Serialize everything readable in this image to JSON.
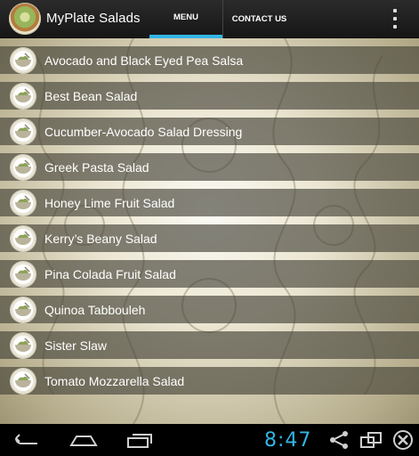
{
  "app": {
    "title": "MyPlate Salads",
    "logo_icon": "salad-plate-icon",
    "accent_color": "#33b5e5"
  },
  "tabs": [
    {
      "label": "MENU",
      "selected": true
    },
    {
      "label": "CONTACT US",
      "selected": false
    }
  ],
  "overflow_icon": "vertical-ellipsis-icon",
  "menu": {
    "item_icon": "salad-bowl-icon",
    "items": [
      {
        "label": "Avocado and Black Eyed Pea Salsa"
      },
      {
        "label": "Best Bean Salad"
      },
      {
        "label": "Cucumber-Avocado Salad Dressing"
      },
      {
        "label": "Greek Pasta Salad"
      },
      {
        "label": "Honey Lime Fruit Salad"
      },
      {
        "label": "Kerry’s Beany Salad"
      },
      {
        "label": "Pina Colada Fruit Salad"
      },
      {
        "label": "Quinoa Tabbouleh"
      },
      {
        "label": "Sister Slaw"
      },
      {
        "label": "Tomato Mozzarella Salad"
      }
    ]
  },
  "system_bar": {
    "time": "8:47",
    "icons": [
      "back-icon",
      "home-icon",
      "recent-apps-icon",
      "share-icon",
      "screen-toggle-icon",
      "close-icon"
    ]
  }
}
